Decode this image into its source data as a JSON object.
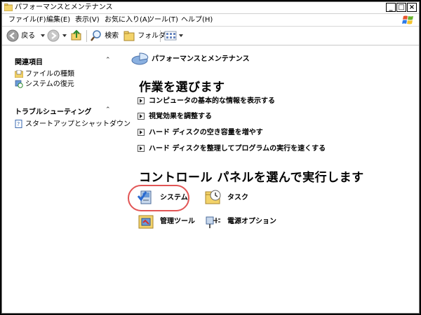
{
  "window": {
    "title": "パフォーマンスとメンテナンス"
  },
  "title_buttons": {
    "minimize": "_",
    "maximize": "□",
    "close": "×"
  },
  "menu": [
    "ファイル(F)",
    "編集(E)",
    "表示(V)",
    "お気に入り(A)",
    "ツール(T)",
    "ヘルプ(H)"
  ],
  "toolbar": {
    "back": "戻る",
    "search": "検索",
    "folders": "フォルダ"
  },
  "sidebar": {
    "related_header": "関連項目",
    "related_items": [
      "ファイルの種類",
      "システムの復元"
    ],
    "troubleshoot_header": "トラブルシューティング",
    "troubleshoot_items": [
      "スタートアップとシャットダウン"
    ]
  },
  "main": {
    "category_title": "パフォーマンスとメンテナンス",
    "pick_task_heading": "作業を選びます",
    "tasks": [
      "コンピュータの基本的な情報を表示する",
      "視覚効果を調整する",
      "ハード ディスクの空き容量を増やす",
      "ハード ディスクを整理してプログラムの実行を速くする"
    ],
    "pick_icon_heading": "コントロール パネルを選んで実行します",
    "icons": [
      "システム",
      "タスク",
      "管理ツール",
      "電源オプション"
    ]
  },
  "colors": {
    "highlight": "#e25555"
  }
}
